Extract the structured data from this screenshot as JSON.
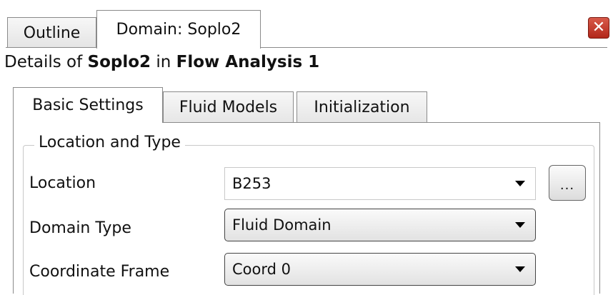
{
  "top_tabs": [
    {
      "label": "Outline",
      "active": false
    },
    {
      "label": "Domain: Soplo2",
      "active": true
    }
  ],
  "details": {
    "prefix": "Details of ",
    "object": "Soplo2",
    "middle": " in ",
    "analysis": "Flow Analysis 1"
  },
  "inner_tabs": [
    {
      "label": "Basic Settings",
      "active": true
    },
    {
      "label": "Fluid Models",
      "active": false
    },
    {
      "label": "Initialization",
      "active": false
    }
  ],
  "group": {
    "title": "Location and Type",
    "location": {
      "label": "Location",
      "value": "B253",
      "browse_label": "..."
    },
    "domain_type": {
      "label": "Domain Type",
      "value": "Fluid Domain"
    },
    "coordinate_frame": {
      "label": "Coordinate Frame",
      "value": "Coord 0"
    }
  },
  "icons": {
    "close": "close-icon",
    "dropdown": "chevron-down-icon"
  },
  "colors": {
    "close_button": "#b2271a"
  }
}
